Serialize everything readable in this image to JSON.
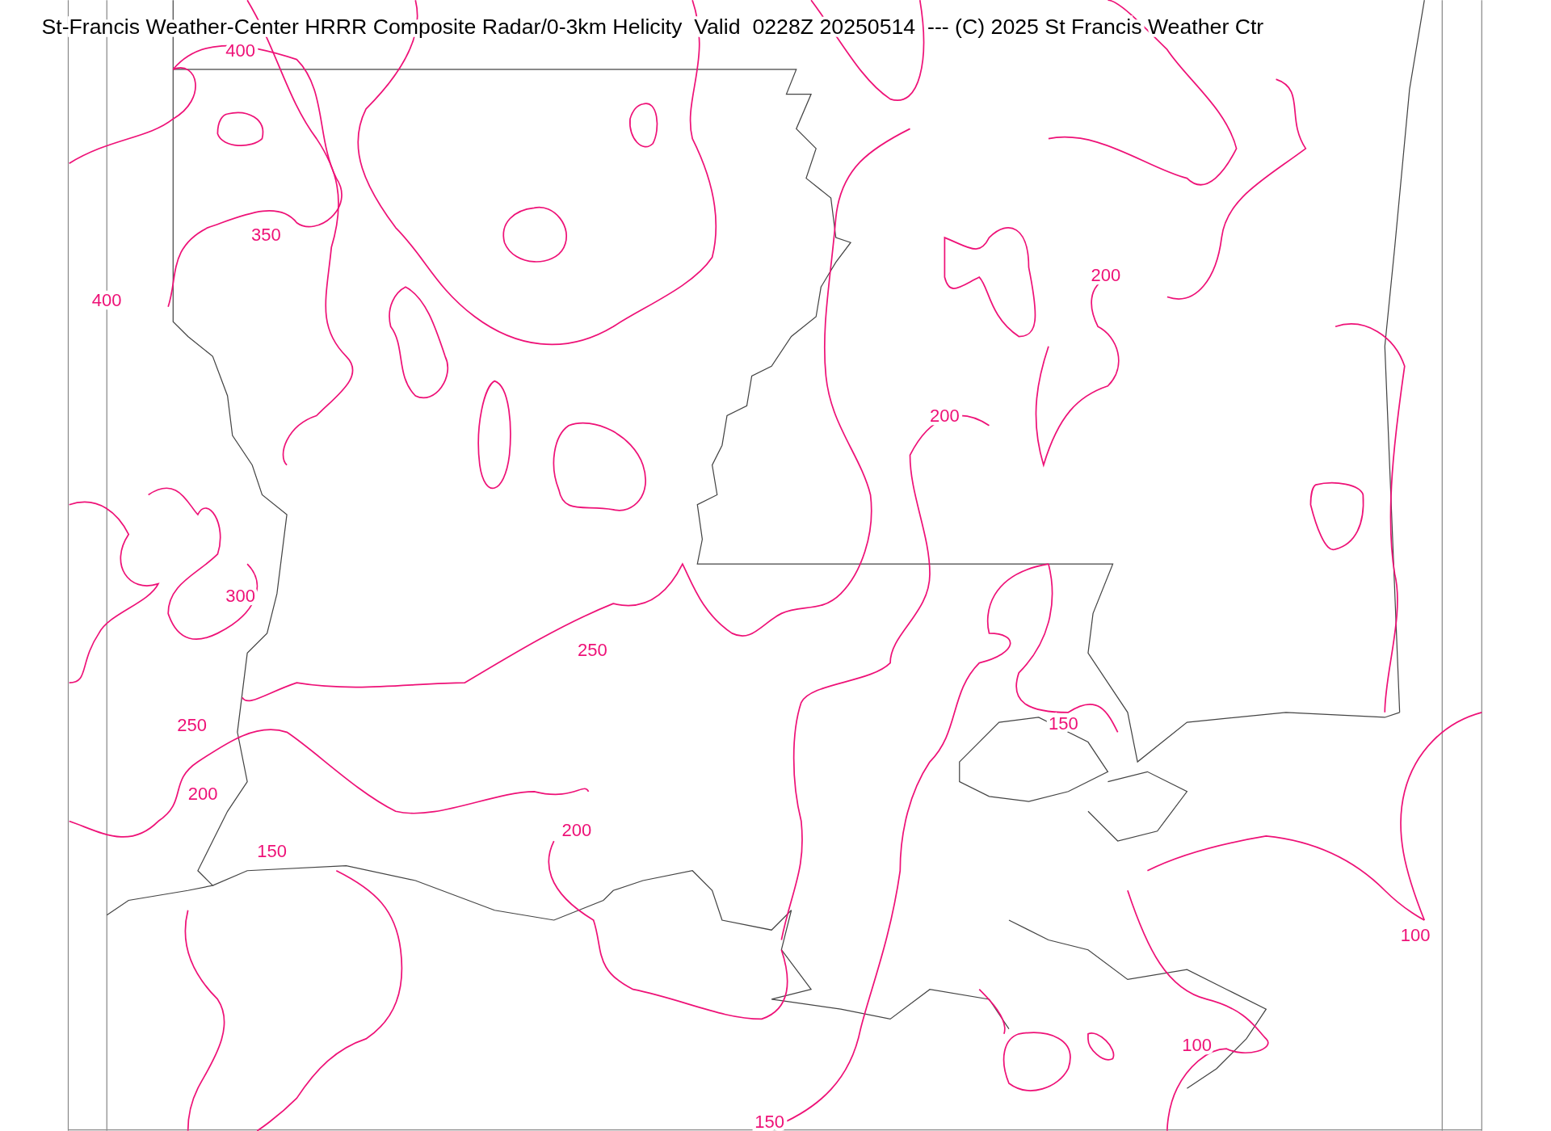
{
  "title": "St-Francis Weather-Center HRRR Composite Radar/0-3km Helicity  Valid  0228Z 20250514  --- (C) 2025 St Francis Weather Ctr",
  "contour_labels": [
    {
      "text": "400"
    },
    {
      "text": "350"
    },
    {
      "text": "400"
    },
    {
      "text": "200"
    },
    {
      "text": "200"
    },
    {
      "text": "300"
    },
    {
      "text": "250"
    },
    {
      "text": "250"
    },
    {
      "text": "150"
    },
    {
      "text": "200"
    },
    {
      "text": "200"
    },
    {
      "text": "150"
    },
    {
      "text": "100"
    },
    {
      "text": "100"
    },
    {
      "text": "150"
    }
  ]
}
